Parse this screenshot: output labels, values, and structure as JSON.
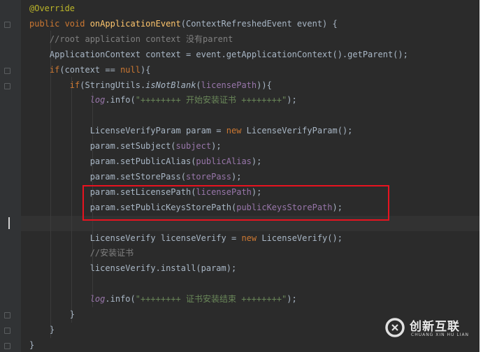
{
  "editor": {
    "lines": [
      [
        {
          "t": "@Override",
          "c": "ann"
        }
      ],
      [
        {
          "t": "public ",
          "c": "kw"
        },
        {
          "t": "void ",
          "c": "kw"
        },
        {
          "t": "onApplicationEvent",
          "c": "mth"
        },
        {
          "t": "(ContextRefreshedEvent event) {",
          "c": ""
        }
      ],
      [
        {
          "t": "    //root application context 没有parent",
          "c": "cmt"
        }
      ],
      [
        {
          "t": "    ApplicationContext context = event.getApplicationContext().getParent();",
          "c": ""
        }
      ],
      [
        {
          "t": "    ",
          "c": ""
        },
        {
          "t": "if",
          "c": "kw"
        },
        {
          "t": "(context == ",
          "c": ""
        },
        {
          "t": "null",
          "c": "kw"
        },
        {
          "t": "){",
          "c": ""
        }
      ],
      [
        {
          "t": "        ",
          "c": ""
        },
        {
          "t": "if",
          "c": "kw"
        },
        {
          "t": "(StringUtils.",
          "c": ""
        },
        {
          "t": "isNotBlank",
          "c": "ital"
        },
        {
          "t": "(",
          "c": ""
        },
        {
          "t": "licensePath",
          "c": "fld"
        },
        {
          "t": ")){",
          "c": ""
        }
      ],
      [
        {
          "t": "            ",
          "c": ""
        },
        {
          "t": "log",
          "c": "fldi"
        },
        {
          "t": ".info(",
          "c": ""
        },
        {
          "t": "\"++++++++ 开始安装证书 ++++++++\"",
          "c": "str"
        },
        {
          "t": ");",
          "c": ""
        }
      ],
      [
        {
          "t": "",
          "c": ""
        }
      ],
      [
        {
          "t": "            LicenseVerifyParam param = ",
          "c": ""
        },
        {
          "t": "new ",
          "c": "kw"
        },
        {
          "t": "LicenseVerifyParam();",
          "c": ""
        }
      ],
      [
        {
          "t": "            param.setSubject(",
          "c": ""
        },
        {
          "t": "subject",
          "c": "fld"
        },
        {
          "t": ");",
          "c": ""
        }
      ],
      [
        {
          "t": "            param.setPublicAlias(",
          "c": ""
        },
        {
          "t": "publicAlias",
          "c": "fld"
        },
        {
          "t": ");",
          "c": ""
        }
      ],
      [
        {
          "t": "            param.setStorePass(",
          "c": ""
        },
        {
          "t": "storePass",
          "c": "fld"
        },
        {
          "t": ");",
          "c": ""
        }
      ],
      [
        {
          "t": "            param.setLicensePath(",
          "c": ""
        },
        {
          "t": "licensePath",
          "c": "fld"
        },
        {
          "t": ");",
          "c": ""
        }
      ],
      [
        {
          "t": "            param.setPublicKeysStorePath(",
          "c": ""
        },
        {
          "t": "publicKeysStorePath",
          "c": "fld"
        },
        {
          "t": ");",
          "c": ""
        }
      ],
      [
        {
          "t": "",
          "c": ""
        }
      ],
      [
        {
          "t": "            LicenseVerify licenseVerify = ",
          "c": ""
        },
        {
          "t": "new ",
          "c": "kw"
        },
        {
          "t": "LicenseVerify();",
          "c": ""
        }
      ],
      [
        {
          "t": "            //安装证书",
          "c": "cmt"
        }
      ],
      [
        {
          "t": "            licenseVerify.install(param);",
          "c": ""
        }
      ],
      [
        {
          "t": "",
          "c": ""
        }
      ],
      [
        {
          "t": "            ",
          "c": ""
        },
        {
          "t": "log",
          "c": "fldi"
        },
        {
          "t": ".info(",
          "c": ""
        },
        {
          "t": "\"++++++++ 证书安装结束 ++++++++\"",
          "c": "str"
        },
        {
          "t": ");",
          "c": ""
        }
      ],
      [
        {
          "t": "        }",
          "c": ""
        }
      ],
      [
        {
          "t": "    }",
          "c": ""
        }
      ],
      [
        {
          "t": "}",
          "c": ""
        }
      ]
    ]
  },
  "watermark": {
    "title": "创新互联",
    "subtitle": "CHUANG XIN HU LIAN"
  }
}
